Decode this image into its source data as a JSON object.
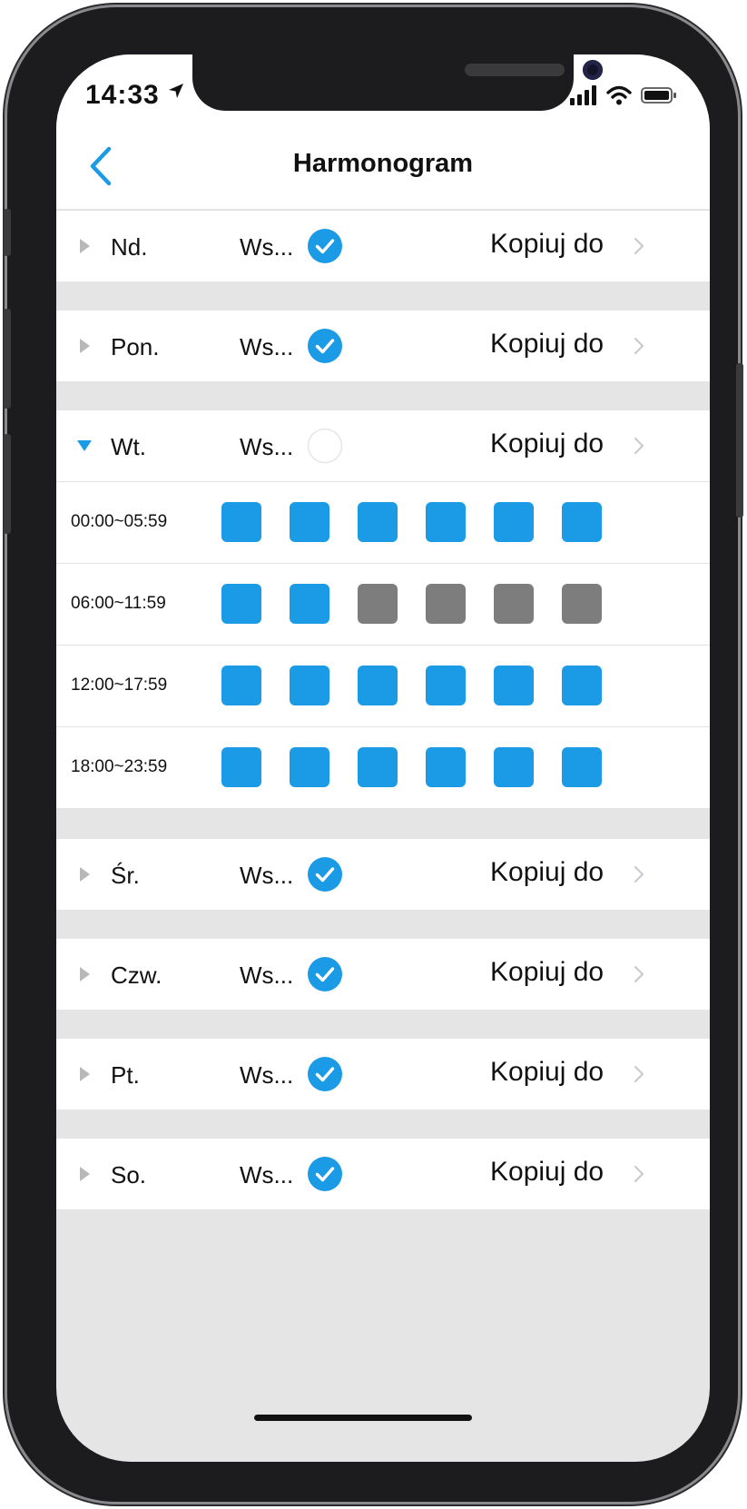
{
  "status_bar": {
    "time": "14:33"
  },
  "nav": {
    "title": "Harmonogram",
    "back_icon": "chevron-left-icon"
  },
  "colors": {
    "accent": "#1b9be5",
    "slot_on": "#1b9be5",
    "slot_off": "#7d7d7d",
    "separator": "#e5e5e5"
  },
  "days": [
    {
      "label": "Nd.",
      "ws": "Ws...",
      "checked": true,
      "expanded": false,
      "copy": "Kopiuj do"
    },
    {
      "label": "Pon.",
      "ws": "Ws...",
      "checked": true,
      "expanded": false,
      "copy": "Kopiuj do"
    },
    {
      "label": "Wt.",
      "ws": "Ws...",
      "checked": false,
      "expanded": true,
      "copy": "Kopiuj do"
    },
    {
      "label": "Śr.",
      "ws": "Ws...",
      "checked": true,
      "expanded": false,
      "copy": "Kopiuj do"
    },
    {
      "label": "Czw.",
      "ws": "Ws...",
      "checked": true,
      "expanded": false,
      "copy": "Kopiuj do"
    },
    {
      "label": "Pt.",
      "ws": "Ws...",
      "checked": true,
      "expanded": false,
      "copy": "Kopiuj do"
    },
    {
      "label": "So.",
      "ws": "Ws...",
      "checked": true,
      "expanded": false,
      "copy": "Kopiuj do"
    }
  ],
  "schedule": [
    {
      "time": "00:00~05:59",
      "slots": [
        true,
        true,
        true,
        true,
        true,
        true
      ]
    },
    {
      "time": "06:00~11:59",
      "slots": [
        true,
        true,
        false,
        false,
        false,
        false
      ]
    },
    {
      "time": "12:00~17:59",
      "slots": [
        true,
        true,
        true,
        true,
        true,
        true
      ]
    },
    {
      "time": "18:00~23:59",
      "slots": [
        true,
        true,
        true,
        true,
        true,
        true
      ]
    }
  ]
}
